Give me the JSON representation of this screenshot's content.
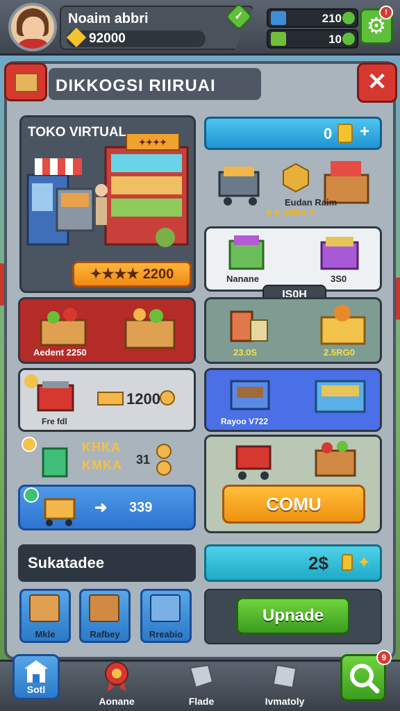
{
  "topbar": {
    "player_name": "Noaim abbri",
    "player_coins": "92000",
    "resource1_value": "210",
    "resource2_value": "10",
    "verify_icon": "check-badge-icon",
    "settings_icon": "gear-icon",
    "settings_notification": "!"
  },
  "header": {
    "title": "DIKKOGSI RIIRUAI"
  },
  "shop": {
    "title": "TOKO VIRTUAL",
    "sign_text": "✦✦✦✦",
    "price_btn": "✦★★★ 2200"
  },
  "top_right": {
    "value": "0",
    "plus": "+",
    "item_label": "Eudan Raim",
    "item_stars": "★★ 2N66 ✦"
  },
  "white_card": {
    "left_label": "Nanane",
    "right_label": "3S0"
  },
  "center_tag": "IS0H",
  "red_card": {
    "label": "Aedent 2250"
  },
  "teal_card": {
    "left_label": "23.0S",
    "right_label": "2.5RG0"
  },
  "grey_card": {
    "label": "Fre fdl",
    "value": "1200"
  },
  "blue_card": {
    "label": "Rayoo V722"
  },
  "sticker_row": {
    "text1": "KHKA",
    "text2": "KMKA",
    "value": "31"
  },
  "blue_wide_btn": {
    "arrow": "➜",
    "value": "339"
  },
  "comu_btn": "COMU",
  "dark_title": "Sukatadee",
  "teal_bar": {
    "value": "2$"
  },
  "tiles": [
    {
      "label": "Mkle"
    },
    {
      "label": "Rafbey"
    },
    {
      "label": "Rreabio"
    }
  ],
  "upgrade_btn": "Upnade",
  "bottom_nav": {
    "home_label": "Sotl",
    "item2_label": "Aonane",
    "item3_label": "Flade",
    "item4_label": "Ivmatoly",
    "search_notification": "9"
  },
  "colors": {
    "accent_green": "#5fbf3a",
    "accent_orange": "#f08a14",
    "accent_red": "#d6382f",
    "accent_blue": "#2c79c8"
  }
}
